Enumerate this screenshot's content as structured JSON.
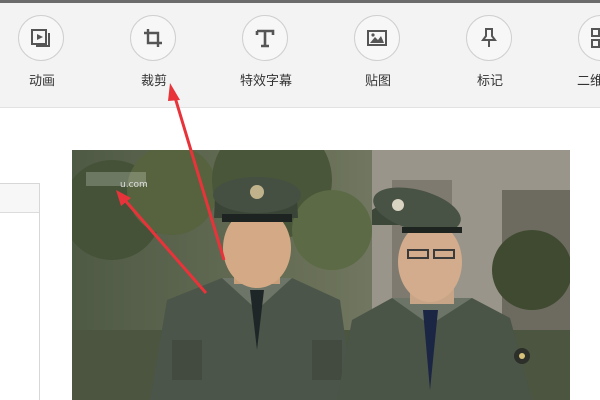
{
  "toolbar": {
    "items": [
      {
        "label": "动画",
        "icon": "animation-icon"
      },
      {
        "label": "裁剪",
        "icon": "crop-icon"
      },
      {
        "label": "特效字幕",
        "icon": "text-effect-icon"
      },
      {
        "label": "贴图",
        "icon": "sticker-icon"
      },
      {
        "label": "标记",
        "icon": "pin-icon"
      },
      {
        "label": "二维",
        "icon": "qrcode-icon"
      }
    ]
  },
  "preview": {
    "watermark": "u.com",
    "badge": "★"
  },
  "colors": {
    "toolbar_bg": "#f3f3f3",
    "icon_color": "#555555",
    "arrow": "#e8333a"
  }
}
